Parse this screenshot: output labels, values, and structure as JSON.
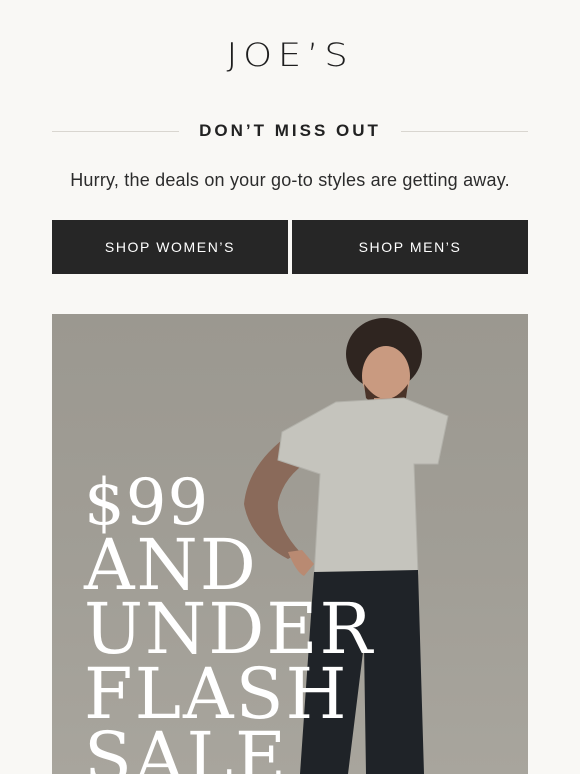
{
  "brand": {
    "logo": "JOE’S"
  },
  "header": {
    "headline": "DON’T MISS OUT"
  },
  "body": {
    "subtext": "Hurry, the deals on your go-to styles are getting away."
  },
  "buttons": {
    "women": "SHOP WOMEN’S",
    "men": "SHOP MEN’S"
  },
  "hero": {
    "price": "$99",
    "line1": "AND",
    "line2": "UNDER",
    "line3": "FLASH",
    "line4": "SALE"
  },
  "colors": {
    "background": "#f9f8f5",
    "button": "#262626",
    "button_text": "#ffffff",
    "hero_background": "#a19e96"
  }
}
